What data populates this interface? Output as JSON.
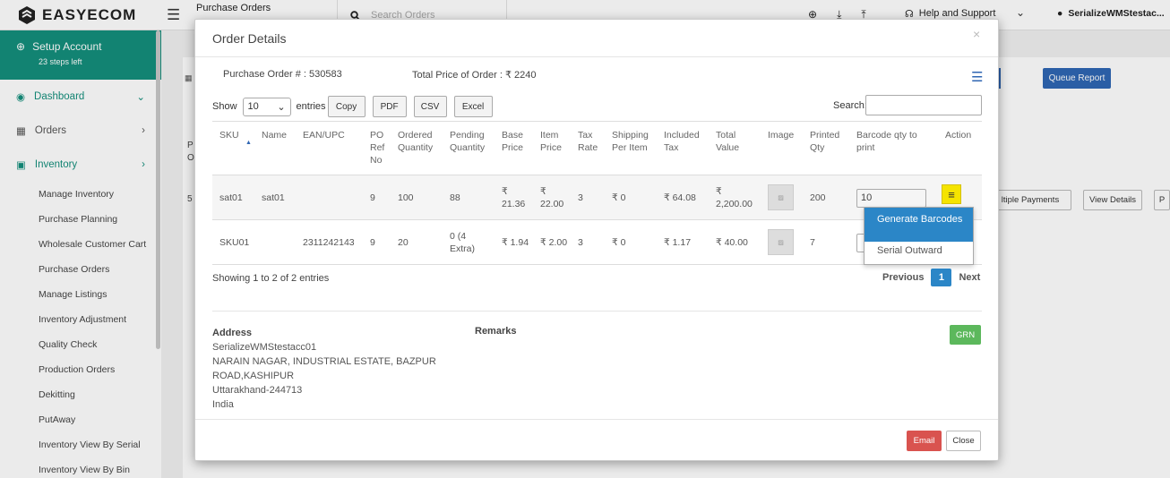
{
  "app": {
    "logo": "EASYECOM"
  },
  "header": {
    "breadcrumb": "Purchase Orders",
    "search_placeholder": "Search Orders",
    "help": "Help and Support",
    "user": "SerializeWMStestac..."
  },
  "sidebar": {
    "setup_title": "Setup Account",
    "setup_sub": "23 steps left",
    "items": [
      {
        "label": "Dashboard"
      },
      {
        "label": "Orders"
      },
      {
        "label": "Inventory"
      }
    ],
    "inventory_sub": [
      "Manage Inventory",
      "Purchase Planning",
      "Wholesale Customer Cart",
      "Purchase Orders",
      "Manage Listings",
      "Inventory Adjustment",
      "Quality Check",
      "Production Orders",
      "Dekitting",
      "PutAway",
      "Inventory View By Serial",
      "Inventory View By Bin"
    ]
  },
  "background": {
    "queue_report": "Queue Report",
    "multiple_payments": "ltiple Payments",
    "view_details": "View Details",
    "edge_letters": [
      "P",
      "O",
      "5"
    ]
  },
  "modal": {
    "title": "Order Details",
    "po_label": "Purchase Order # :",
    "po_value": "530583",
    "total_label": "Total Price of Order :",
    "total_value": "₹ 2240",
    "show": "Show",
    "entries_value": "10",
    "entries": "entries",
    "buttons": [
      "Copy",
      "PDF",
      "CSV",
      "Excel"
    ],
    "search_label": "Search:",
    "columns": [
      "SKU",
      "Name",
      "EAN/UPC",
      "PO Ref No",
      "Ordered Quantity",
      "Pending Quantity",
      "Base Price",
      "Item Price",
      "Tax Rate",
      "Shipping Per Item",
      "Included Tax",
      "Total Value",
      "Image",
      "Printed Qty",
      "Barcode qty to print",
      "Action"
    ],
    "rows": [
      {
        "sku": "sat01",
        "name": "sat01",
        "ean": "",
        "po": "9",
        "ordered": "100",
        "pending": "88",
        "base": "₹ 21.36",
        "item": "₹ 22.00",
        "tax": "3",
        "ship": "₹ 0",
        "incl": "₹ 64.08",
        "total": "₹ 2,200.00",
        "printed": "200",
        "barcode": "10"
      },
      {
        "sku": "SKU01",
        "name": "",
        "ean": "2311242143",
        "po": "9",
        "ordered": "20",
        "pending": "0 (4 Extra)",
        "base": "₹ 1.94",
        "item": "₹ 2.00",
        "tax": "3",
        "ship": "₹ 0",
        "incl": "₹ 1.17",
        "total": "₹ 40.00",
        "printed": "7",
        "barcode": ""
      }
    ],
    "dropdown": [
      "Generate Barcodes",
      "Serial Outward"
    ],
    "showing": "Showing 1 to 2 of 2 entries",
    "pager": {
      "prev": "Previous",
      "page": "1",
      "next": "Next"
    },
    "address_title": "Address",
    "address_lines": [
      "SerializeWMStestacc01",
      "NARAIN NAGAR, INDUSTRIAL ESTATE, BAZPUR",
      "ROAD,KASHIPUR",
      "Uttarakhand-244713",
      "India"
    ],
    "remarks": "Remarks",
    "grn": "GRN",
    "email": "Email",
    "close": "Close"
  },
  "colors": {
    "teal": "#148f7c",
    "blue": "#2f66b3",
    "grn": "#5cb85c",
    "email": "#d9534f",
    "yellow": "#f5e400"
  }
}
